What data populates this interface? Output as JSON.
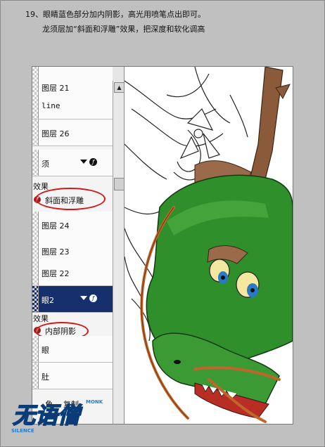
{
  "instructions": {
    "line1": "19、眼睛蓝色部分加内阴影，高光用喷笔点出即可。",
    "line2": "龙须层加“斜面和浮雕”效果，把深度和软化调高"
  },
  "layers_panel": {
    "toolbar_icons": [
      "brush-icon",
      "square-icon",
      "move-icon",
      "lock-icon"
    ],
    "rows": [
      {
        "label": "图层 21",
        "selected": false,
        "has_fx": false
      },
      {
        "label": "line",
        "selected": false,
        "has_fx": false
      },
      {
        "label": "图层 26",
        "selected": false,
        "has_fx": false
      },
      {
        "label": "须",
        "selected": false,
        "has_fx": true
      },
      {
        "label": "图层 24",
        "selected": false,
        "has_fx": false
      },
      {
        "label": "图层 23",
        "selected": false,
        "has_fx": false
      },
      {
        "label": "图层 22",
        "selected": false,
        "has_fx": false
      },
      {
        "label": "眼2",
        "selected": true,
        "has_fx": true
      },
      {
        "label": "眼",
        "selected": false,
        "has_fx": false
      },
      {
        "label": "肚",
        "selected": false,
        "has_fx": false
      }
    ],
    "effects_label_1": "效果",
    "effect_1": "斜面和浮雕",
    "effects_label_2": "效果",
    "effect_2": "内部阴影",
    "bottom_label": "角",
    "bottom_label_2": "复制"
  },
  "logo": {
    "main_text": "无语僧",
    "small_text": "SILENCE",
    "small_text_2": "MONK"
  },
  "colors": {
    "selection": "#16306e",
    "highlight_oval": "#d01818",
    "dragon_green": "#2f8f2a",
    "horn_brown": "#8a5a3a"
  }
}
